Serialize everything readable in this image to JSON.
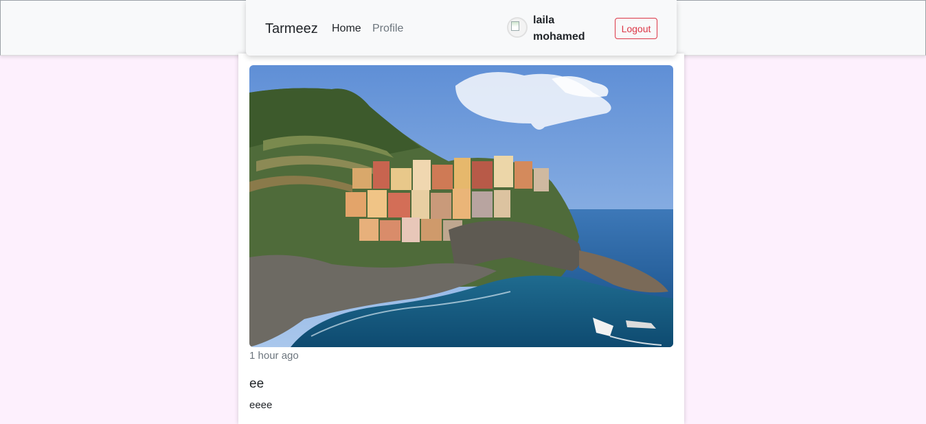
{
  "navbar": {
    "brand": "Tarmeez",
    "links": [
      {
        "label": "Home",
        "active": true
      },
      {
        "label": "Profile",
        "active": false
      }
    ],
    "user": {
      "name_line1": "laila",
      "name_line2": "mohamed",
      "avatar_icon": "broken-image-icon"
    },
    "logout_label": "Logout"
  },
  "post": {
    "image_subject": "coastal-village-photo",
    "time": "1 hour ago",
    "title": "ee",
    "body": "eeee"
  },
  "colors": {
    "page_bg": "#fdf0fd",
    "navbar_bg": "#f8f9fa",
    "danger": "#dc3545",
    "muted": "#6c757d"
  }
}
